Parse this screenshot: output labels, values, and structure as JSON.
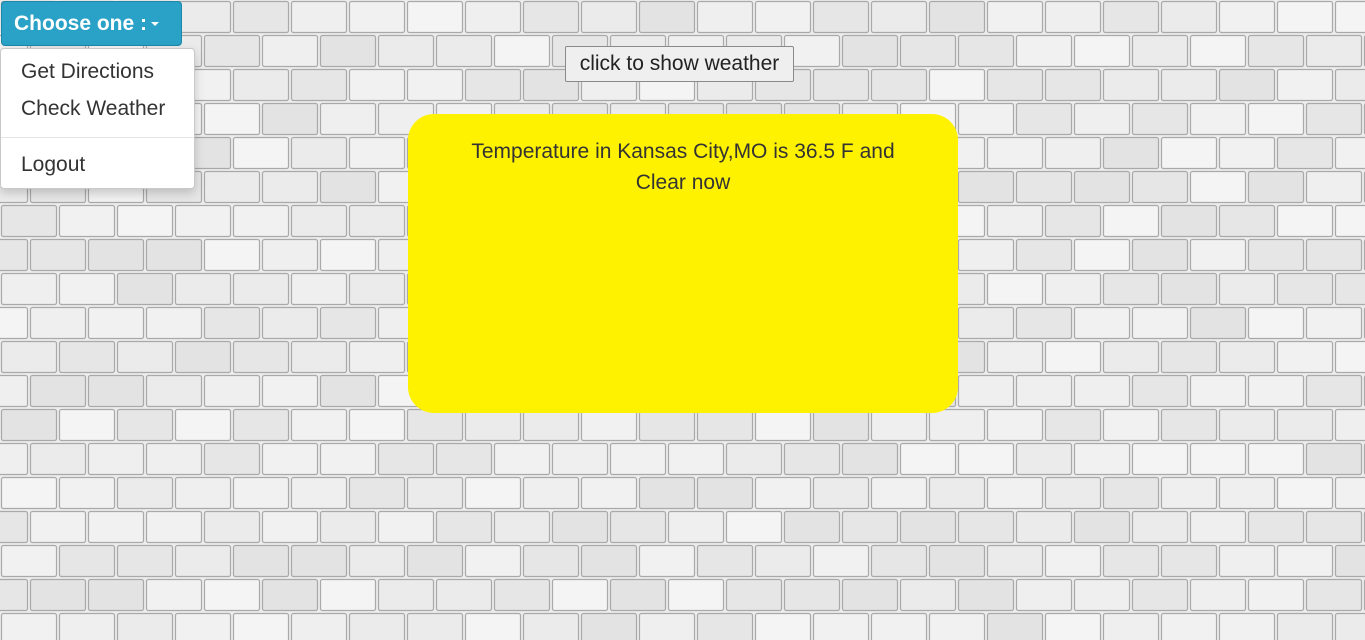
{
  "nav": {
    "dropdown_label": "Choose one :",
    "menu_items": [
      {
        "label": "Get Directions"
      },
      {
        "label": "Check Weather"
      },
      {
        "label": "Logout"
      }
    ]
  },
  "weather": {
    "button_label": "click to show weather",
    "result_line1": "Temperature in Kansas City,MO is 36.5 F and",
    "result_line2": "Clear now"
  },
  "colors": {
    "dropdown_bg": "#2aa1c6",
    "card_bg": "#fff200",
    "wall": "#ececec"
  },
  "icons": {
    "dropdown_caret": "caret-down-icon"
  }
}
